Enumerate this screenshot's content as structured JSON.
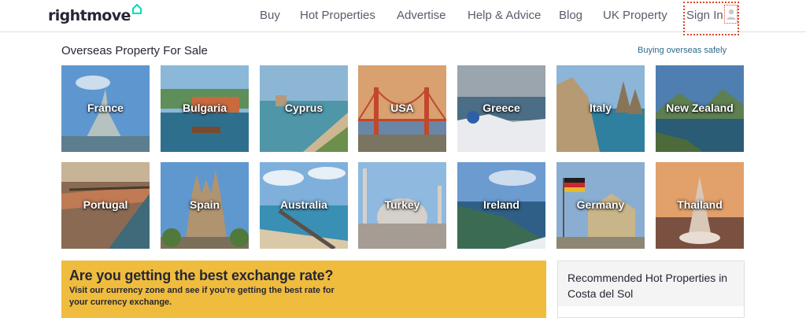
{
  "header": {
    "logo_text": "rightmove",
    "nav": [
      "Buy",
      "Hot Properties",
      "Advertise",
      "Help & Advice",
      "Blog",
      "UK Property"
    ],
    "sign_in": "Sign In"
  },
  "section": {
    "title": "Overseas Property For Sale",
    "safe_link": "Buying overseas safely"
  },
  "countries": [
    {
      "name": "France",
      "sky": "#5e97cf",
      "ground": "#5c7e8e",
      "accent": "#b6c2c0"
    },
    {
      "name": "Bulgaria",
      "sky": "#8bb8d8",
      "ground": "#2f6f8e",
      "accent": "#c86a3e"
    },
    {
      "name": "Cyprus",
      "sky": "#8db6d5",
      "ground": "#4f96a8",
      "accent": "#cdb793"
    },
    {
      "name": "USA",
      "sky": "#d9a070",
      "ground": "#6a86a6",
      "accent": "#c1482c"
    },
    {
      "name": "Greece",
      "sky": "#9aa5ad",
      "ground": "#4b6d85",
      "accent": "#e9ebee"
    },
    {
      "name": "Italy",
      "sky": "#8cb5d8",
      "ground": "#2f7f9f",
      "accent": "#b59a73"
    },
    {
      "name": "New Zealand",
      "sky": "#4e7fb0",
      "ground": "#2a5c76",
      "accent": "#5e7f52"
    },
    {
      "name": "Portugal",
      "sky": "#c7b497",
      "ground": "#8a6a53",
      "accent": "#c07b54"
    },
    {
      "name": "Spain",
      "sky": "#5e98cf",
      "ground": "#7c6f5a",
      "accent": "#b09470"
    },
    {
      "name": "Australia",
      "sky": "#7fb0dc",
      "ground": "#3a8fb5",
      "accent": "#d9c9a8"
    },
    {
      "name": "Turkey",
      "sky": "#8fb9de",
      "ground": "#a59c93",
      "accent": "#d5d0c9"
    },
    {
      "name": "Ireland",
      "sky": "#6c9bcf",
      "ground": "#3c6b54",
      "accent": "#2f5f86"
    },
    {
      "name": "Germany",
      "sky": "#8aaed2",
      "ground": "#8f8573",
      "accent": "#c9b58a"
    },
    {
      "name": "Thailand",
      "sky": "#e2a06a",
      "ground": "#7a5040",
      "accent": "#d9c7b8"
    }
  ],
  "banner": {
    "title": "Are you getting the best exchange rate?",
    "body": "Visit our currency zone and see if you're getting the best rate for your currency exchange."
  },
  "hot": {
    "title": "Recommended Hot Properties in Costa del Sol"
  },
  "colors": {
    "brand_teal": "#00deb6",
    "banner_yellow": "#efbc3d",
    "link_blue": "#2e6a8a",
    "focus_red": "#d9482b"
  }
}
